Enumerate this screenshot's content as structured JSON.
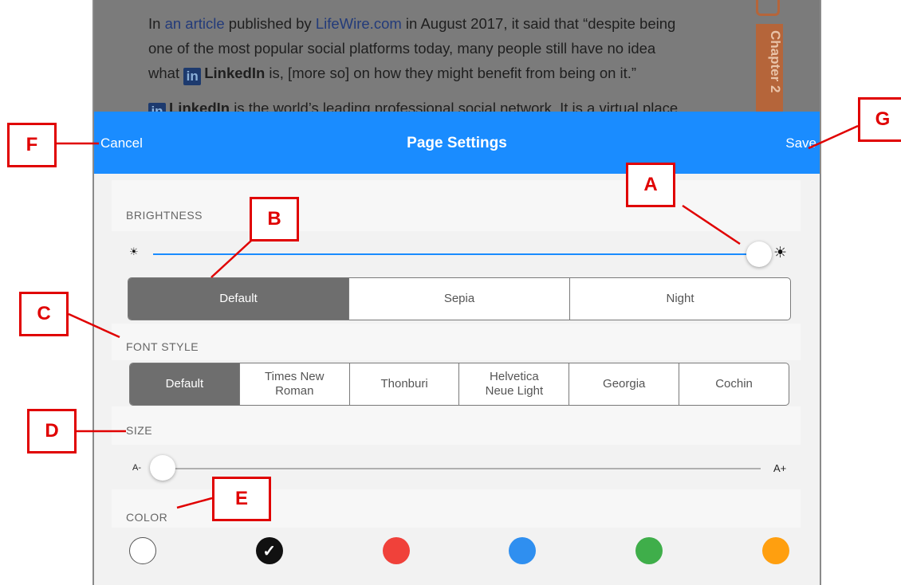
{
  "article": {
    "line1_pre": "In ",
    "line1_link1": "an article",
    "line1_mid": " published by ",
    "line1_link2": "LifeWire.com",
    "line1_post": " in August 2017, it said that “despite being",
    "line2": "one of the most popular social platforms today, many people still have no idea",
    "line3_pre": "what ",
    "line3_logo": "in",
    "line3_bold": "LinkedIn",
    "line3_post": " is, [more so] on how they might benefit from being on it.”",
    "p2_logo": "in",
    "p2_bold": "LinkedIn",
    "p2_text": " is the world’s leading professional social network. It is a virtual place",
    "chapter_tab": "Chapter 2"
  },
  "navbar": {
    "cancel_label": "Cancel",
    "title": "Page Settings",
    "save_label": "Save"
  },
  "settings": {
    "brightness": {
      "label": "BRIGHTNESS",
      "min_icon": "sun-small-icon",
      "max_icon": "sun-large-icon",
      "value": 1.0,
      "min_glyph": "☀",
      "max_glyph": "☀"
    },
    "theme": {
      "options": [
        "Default",
        "Sepia",
        "Night"
      ],
      "selected": "Default"
    },
    "font_style": {
      "label": "FONT STYLE",
      "options": [
        {
          "line1": "Default",
          "line2": ""
        },
        {
          "line1": "Times New",
          "line2": "Roman"
        },
        {
          "line1": "Thonburi",
          "line2": ""
        },
        {
          "line1": "Helvetica",
          "line2": "Neue Light"
        },
        {
          "line1": "Georgia",
          "line2": ""
        },
        {
          "line1": "Cochin",
          "line2": ""
        }
      ],
      "selected": "Default"
    },
    "size": {
      "label": "SIZE",
      "min_label": "A-",
      "max_label": "A+",
      "value": 0.0
    },
    "color": {
      "label": "COLOR",
      "swatches": [
        {
          "name": "white",
          "hex": "#ffffff",
          "selected": false
        },
        {
          "name": "black",
          "hex": "#111111",
          "selected": true
        },
        {
          "name": "red",
          "hex": "#f0413a",
          "selected": false
        },
        {
          "name": "blue",
          "hex": "#2f8ff0",
          "selected": false
        },
        {
          "name": "green",
          "hex": "#3fae4a",
          "selected": false
        },
        {
          "name": "orange",
          "hex": "#ff9f0f",
          "selected": false
        }
      ],
      "check_glyph": "✓"
    }
  },
  "callouts": {
    "A": "A",
    "B": "B",
    "C": "C",
    "D": "D",
    "E": "E",
    "F": "F",
    "G": "G"
  },
  "colors": {
    "nav_bar": "#1a8cff",
    "annotation": "#e00000",
    "slider_active": "#1a8cff",
    "segment_selected": "#6e6e6e"
  }
}
